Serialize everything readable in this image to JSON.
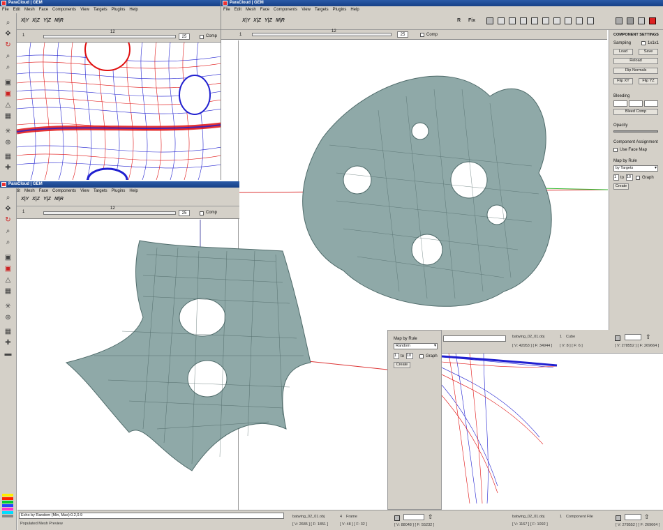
{
  "app_title": "ParaCloud | GEM",
  "menu": [
    "File",
    "Edit",
    "Mesh",
    "Face",
    "Components",
    "View",
    "Targets",
    "Plugins",
    "Help"
  ],
  "axis_buttons": [
    "X|Y",
    "X|Z",
    "Y|Z",
    "M|R"
  ],
  "frame": {
    "start": "1",
    "mid": "12",
    "end": "25",
    "comp_label": "Comp"
  },
  "toolbar_right": {
    "r_label": "R",
    "fix_label": "Fix"
  },
  "component_settings": {
    "title": "COMPONENT SETTINGS",
    "sampling_label": "Sampling",
    "sampling_check": "1x1x1",
    "load": "Load",
    "save": "Save",
    "reload": "Reload",
    "flip_normals": "Flip Normals",
    "flip_xy": "Flip XY",
    "flip_yz": "Flip YZ",
    "bleeding": "Bleeding",
    "bleed_comp": "Bleed Comp",
    "opacity": "Opacity",
    "assignment": "Component Assignment",
    "use_face_map": "Use Face Map",
    "map_by_rule": "Map by Rule",
    "rule_value": "by Targets",
    "range_from": "1",
    "range_to_label": "to",
    "range_to": "10",
    "graph_label": "Graph",
    "create": "Create"
  },
  "popup": {
    "map_by_rule": "Map by Rule",
    "rule_value": "Random",
    "range_from": "1",
    "range_to_label": "to",
    "range_to": "10",
    "graph_label": "Graph",
    "create": "Create"
  },
  "status_main": {
    "echo": "Echo by Random (Min, Max):0.2,0.9",
    "preview": "Populated Mesh Preview",
    "file1": "batwing_02_01.obj",
    "counts1": "[ V: 2685 ] [ F: 1851 ]",
    "frame_num": "4",
    "frame_label": "Frame",
    "counts2": "[ V: 48 ] [ F: 32 ]",
    "file2": "batwing_02_01.obj",
    "counts3": "[ V: 88048 ] [ F: 55232 ]",
    "counts4": "[ V: 1167 ] [ F: 1092 ]",
    "comp_num": "1",
    "comp_label": "Component File",
    "counts5": "[ V: 278552 ] [ F: 269664 ]"
  },
  "status_top_right": {
    "file": "batwing_02_01.obj",
    "counts": "[ V: 42953 ] [ F: 34944 ]",
    "cube_num": "1",
    "cube_label": "Cube",
    "cube_counts": "[ V: 8 ] [ F: 6 ]",
    "total": "[ V: 278552 ] [ F: 269664 ]"
  },
  "palette_colors": [
    "#ffee00",
    "#ff2200",
    "#00cc33",
    "#2244ff",
    "#ff33cc",
    "#00ddff",
    "#888888"
  ]
}
